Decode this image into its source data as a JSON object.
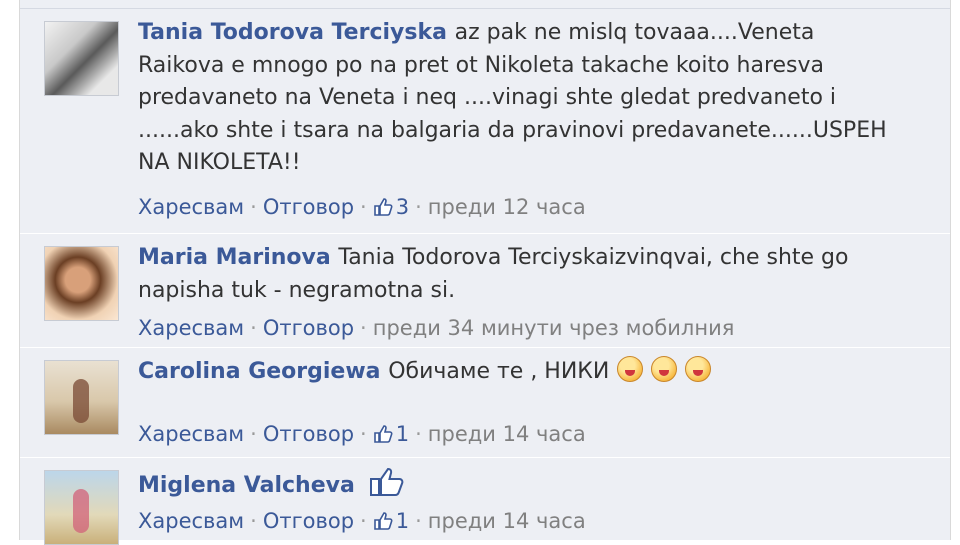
{
  "comments": [
    {
      "author": "Tania Todorova Terciyska",
      "text_lines": [
        "az pak ne mislq tovaaa....Veneta",
        "Raikova e mnogo po na pret ot Nikoleta takache koito haresva",
        "predavaneto na Veneta i neq ....vinagi shte gledat predvaneto i",
        "......ako shte i tsara na balgaria da pravinovi predavanete......USPEH",
        "NA NIKOLETA!!"
      ],
      "like_label": "Харесвам",
      "reply_label": "Отговор",
      "likes": "3",
      "time": "преди 12 часа",
      "avatar_icon": "profile-photo"
    },
    {
      "author": "Maria Marinova",
      "text_lines": [
        "Tania Todorova Terciyskaizvinqvai, che shte go",
        "napisha tuk - negramotna si."
      ],
      "like_label": "Харесвам",
      "reply_label": "Отговор",
      "likes": "",
      "time": "преди 34 минути чрез мобилния",
      "avatar_icon": "profile-photo"
    },
    {
      "author": "Carolina Georgiewa",
      "text": "Обичаме те , НИКИ",
      "emoticons": [
        "smiley-icon",
        "smiley-icon",
        "smiley-icon"
      ],
      "like_label": "Харесвам",
      "reply_label": "Отговор",
      "likes": "1",
      "time": "преди 14 часа",
      "avatar_icon": "profile-photo"
    },
    {
      "author": "Miglena Valcheva",
      "text": "",
      "emoticons": [
        "thumbs-up-icon"
      ],
      "like_label": "Харесвам",
      "reply_label": "Отговор",
      "likes": "1",
      "time": "преди 14 часа",
      "avatar_icon": "profile-photo"
    }
  ],
  "separator": "·",
  "colors": {
    "author": "#3b5998",
    "background": "#edeff4",
    "text": "#333333",
    "meta": "#808080"
  }
}
